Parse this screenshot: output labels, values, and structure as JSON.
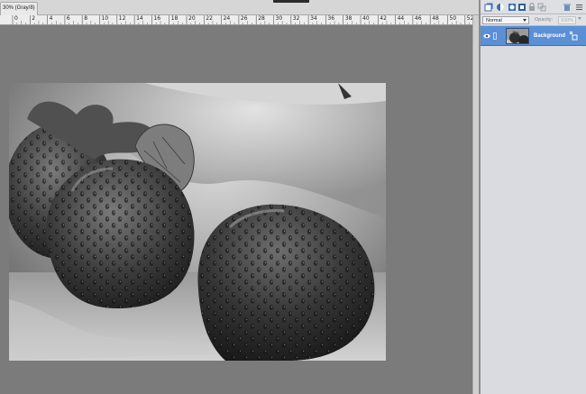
{
  "document": {
    "tab_title": "30% (Gray/8)"
  },
  "ruler": {
    "unit": "inches",
    "labels": [
      "0",
      "2",
      "4",
      "6",
      "8",
      "10",
      "12",
      "14",
      "16",
      "18",
      "20",
      "22",
      "24",
      "26",
      "28",
      "30",
      "32",
      "34",
      "36",
      "38",
      "40",
      "42",
      "44",
      "46",
      "48",
      "50",
      "52"
    ]
  },
  "layers_panel": {
    "toolbar_icons": [
      "new-layer-icon",
      "new-fill-layer-icon",
      "add-mask-icon",
      "lock-transparent-icon",
      "lock-all-icon",
      "link-layers-icon",
      "delete-layer-icon",
      "panel-menu-icon"
    ],
    "blend_mode": "Normal",
    "opacity_label": "Opacity:",
    "opacity_value": "100%",
    "layers": [
      {
        "name": "Background",
        "visible": true,
        "selected": true
      }
    ]
  },
  "colors": {
    "selection_blue": "#5b8fd6",
    "workspace_gray": "#7b7b7b"
  }
}
